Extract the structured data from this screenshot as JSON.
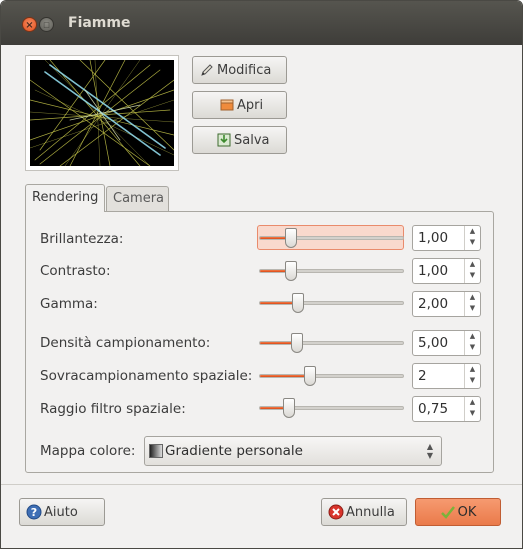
{
  "window": {
    "title": "Fiamme",
    "close_glyph": "×",
    "maximize_glyph": "□"
  },
  "actions": {
    "modifica": {
      "label": "Modifica",
      "icon": "pencil-icon"
    },
    "apri": {
      "label": "Apri",
      "icon": "folder-open-icon"
    },
    "salva": {
      "label": "Salva",
      "icon": "save-icon"
    }
  },
  "tabs": [
    {
      "label": "Rendering",
      "active": true
    },
    {
      "label": "Camera",
      "active": false
    }
  ],
  "rendering": {
    "rows": [
      {
        "label": "Brillantezza:",
        "value": "1,00",
        "slider_fraction": 0.22,
        "highlighted": true
      },
      {
        "label": "Contrasto:",
        "value": "1,00",
        "slider_fraction": 0.22,
        "highlighted": false
      },
      {
        "label": "Gamma:",
        "value": "2,00",
        "slider_fraction": 0.27,
        "highlighted": false
      },
      {
        "label": "Densità campionamento:",
        "value": "5,00",
        "slider_fraction": 0.26,
        "highlighted": false
      },
      {
        "label": "Sovracampionamento spaziale:",
        "value": "2",
        "slider_fraction": 0.35,
        "highlighted": false
      },
      {
        "label": "Raggio filtro spaziale:",
        "value": "0,75",
        "slider_fraction": 0.21,
        "highlighted": false
      }
    ],
    "palette": {
      "label": "Mappa colore:",
      "value": "Gradiente personale"
    }
  },
  "footer": {
    "help": {
      "label": "Aiuto",
      "icon": "help-icon"
    },
    "cancel": {
      "label": "Annulla",
      "icon": "cancel-icon"
    },
    "ok": {
      "label": "OK",
      "icon": "check-icon"
    }
  },
  "colors": {
    "accent": "#dd4814",
    "titlebar": "#3e3d39",
    "ok_button": "#ea7a4a"
  }
}
